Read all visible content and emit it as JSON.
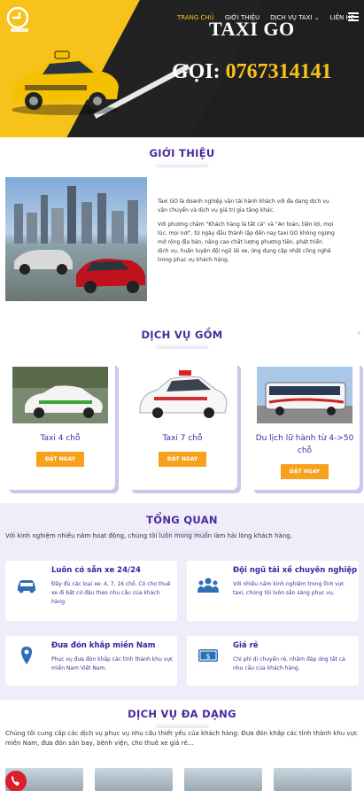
{
  "header": {
    "nav": [
      {
        "label": "TRANG CHỦ",
        "active": true
      },
      {
        "label": "GIỚI THIỆU",
        "active": false
      },
      {
        "label": "DỊCH VỤ TAXI",
        "active": false,
        "has_dropdown": true
      },
      {
        "label": "LIÊN HỆ",
        "active": false
      }
    ],
    "title": "TAXI GO",
    "call_prefix": "GỌI:",
    "call_number": "0767314141",
    "colors": {
      "brand_yellow": "#f7c21a",
      "dark": "#1f1f1f"
    }
  },
  "intro": {
    "title": "GIỚI THIỆU",
    "p1": "Taxi GO là doanh nghiệp vận tải hành khách với đa dạng dịch vụ vận chuyển và dịch vụ giá trị gia tăng khác.",
    "p2": "Với phương châm \"Khách hàng là tất cả\" và \"An toàn, tiện lợi, mọi lúc, mọi nơi\", từ ngày đầu thành lập đến nay taxi GO không ngừng mở rộng địa bàn, nâng cao chất lượng phương tiện, phát triển dịch vụ, huấn luyện đội ngũ lái xe, ứng dụng cập nhật công nghệ trong phục vụ khách hàng."
  },
  "services": {
    "title": "DỊCH VỤ GỒM",
    "items": [
      {
        "name": "Taxi 4 chỗ",
        "button": "ĐẶT NGAY"
      },
      {
        "name": "Taxi 7 chỗ",
        "button": "ĐẶT NGAY"
      },
      {
        "name": "Du lịch lữ hành từ 4->50 chỗ",
        "button": "ĐẶT NGAY"
      }
    ]
  },
  "overview": {
    "title": "TỔNG QUAN",
    "subtitle": "Với kinh nghiệm nhiều năm hoạt động, chúng tôi luôn mong muốn làm hài lòng khách hàng.",
    "features": [
      {
        "icon": "car-icon",
        "title": "Luôn có sẵn xe 24/24",
        "text": "Đầy đủ các loại xe: 4, 7, 16 chỗ. Có cho thuê xe đi bất cứ đâu theo nhu cầu của khách hàng."
      },
      {
        "icon": "team-icon",
        "title": "Đội ngũ tài xế chuyên nghiệp",
        "text": "Với nhiều năm kinh nghiệm trong lĩnh vực taxi, chúng tôi luôn sẵn sàng phục vụ."
      },
      {
        "icon": "location-pin-icon",
        "title": "Đưa đón khắp miền Nam",
        "text": "Phục vụ đưa đón khắp các tỉnh thành khu vực miền Nam Việt Nam."
      },
      {
        "icon": "money-icon",
        "title": "Giá rẻ",
        "text": "Chỉ phí di chuyển rẻ, nhằm đáp ứng tất cả nhu cầu của khách hàng."
      }
    ]
  },
  "diverse": {
    "title": "DỊCH VỤ ĐA DẠNG",
    "text": "Chúng tôi cung cấp các dịch vụ phục vụ nhu cầu thiết yếu của khách hàng: Đưa đón khắp các tỉnh thành khu vực miền Nam, đưa đón sân bay, bệnh viện, cho thuê xe giá rẻ…"
  }
}
